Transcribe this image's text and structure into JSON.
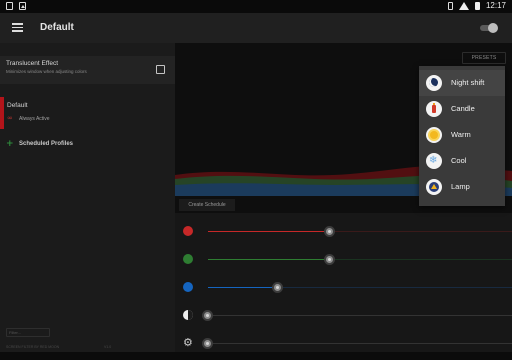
{
  "status_bar": {
    "time": "12:17",
    "left_icons": [
      "notification-icon",
      "image-icon"
    ],
    "right_icons": [
      "vibrate-icon",
      "wifi-icon",
      "battery-icon"
    ]
  },
  "app_bar": {
    "title": "Default",
    "menu_icon": "hamburger-menu-icon",
    "toggle_on": false
  },
  "left_panel": {
    "translucent": {
      "title": "Translucent Effect",
      "subtitle": "Minimizes window when adjusting colors",
      "checked": false
    },
    "active_profile": {
      "name": "Default",
      "mode": "Always Active",
      "mode_icon": "infinity-icon"
    },
    "scheduled_profiles_label": "Scheduled Profiles",
    "footer_field_text": "Filter...",
    "footer_left": "SCREEN FILTER BY RED MOON",
    "footer_right": "V1.0"
  },
  "right_panel": {
    "presets_label": "PRESETS",
    "create_schedule_label": "Create Schedule",
    "sliders": [
      {
        "name": "red",
        "icon": "red-dot-icon",
        "color": "#c62828",
        "value": 0.4
      },
      {
        "name": "green",
        "icon": "green-dot-icon",
        "color": "#2e7d32",
        "value": 0.4
      },
      {
        "name": "blue",
        "icon": "blue-dot-icon",
        "color": "#1565c0",
        "value": 0.23
      },
      {
        "name": "dim",
        "icon": "contrast-icon",
        "color": "#9e9e9e",
        "value": 0.0
      },
      {
        "name": "settings",
        "icon": "gear-icon",
        "color": "#9e9e9e",
        "value": 0.0
      }
    ]
  },
  "presets_menu": {
    "items": [
      {
        "label": "Night shift",
        "icon": "moon-icon",
        "selected": true
      },
      {
        "label": "Candle",
        "icon": "candle-icon",
        "selected": false
      },
      {
        "label": "Warm",
        "icon": "sun-icon",
        "selected": false
      },
      {
        "label": "Cool",
        "icon": "snowflake-icon",
        "selected": false
      },
      {
        "label": "Lamp",
        "icon": "lamp-icon",
        "selected": false
      }
    ]
  },
  "colors": {
    "accent_red": "#b3141a",
    "background": "#141414",
    "menu_background": "#3a3a3a"
  }
}
